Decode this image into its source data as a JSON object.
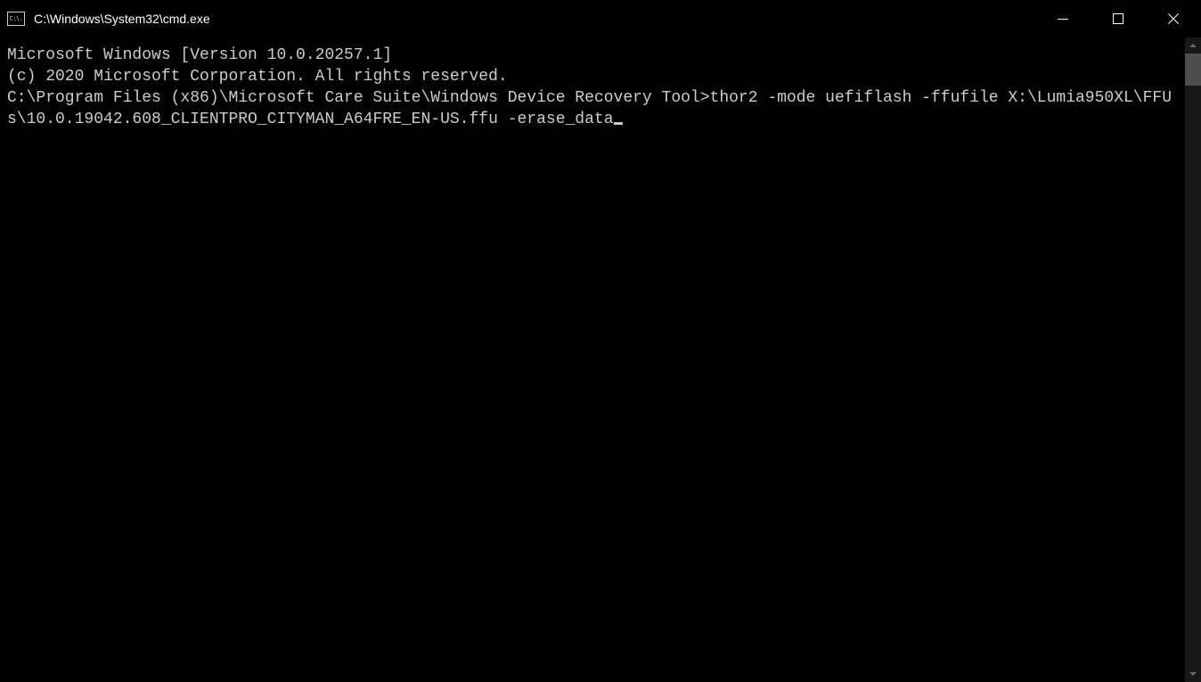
{
  "window": {
    "title": "C:\\Windows\\System32\\cmd.exe",
    "icon_label": "C:\\."
  },
  "terminal": {
    "lines": [
      "Microsoft Windows [Version 10.0.20257.1]",
      "(c) 2020 Microsoft Corporation. All rights reserved.",
      "",
      "C:\\Program Files (x86)\\Microsoft Care Suite\\Windows Device Recovery Tool>thor2 -mode uefiflash -ffufile X:\\Lumia950XL\\FFUs\\10.0.19042.608_CLIENTPRO_CITYMAN_A64FRE_EN-US.ffu -erase_data"
    ],
    "prompt": "C:\\Program Files (x86)\\Microsoft Care Suite\\Windows Device Recovery Tool>",
    "command": "thor2 -mode uefiflash -ffufile X:\\Lumia950XL\\FFUs\\10.0.19042.608_CLIENTPRO_CITYMAN_A64FRE_EN-US.ffu -erase_data"
  }
}
